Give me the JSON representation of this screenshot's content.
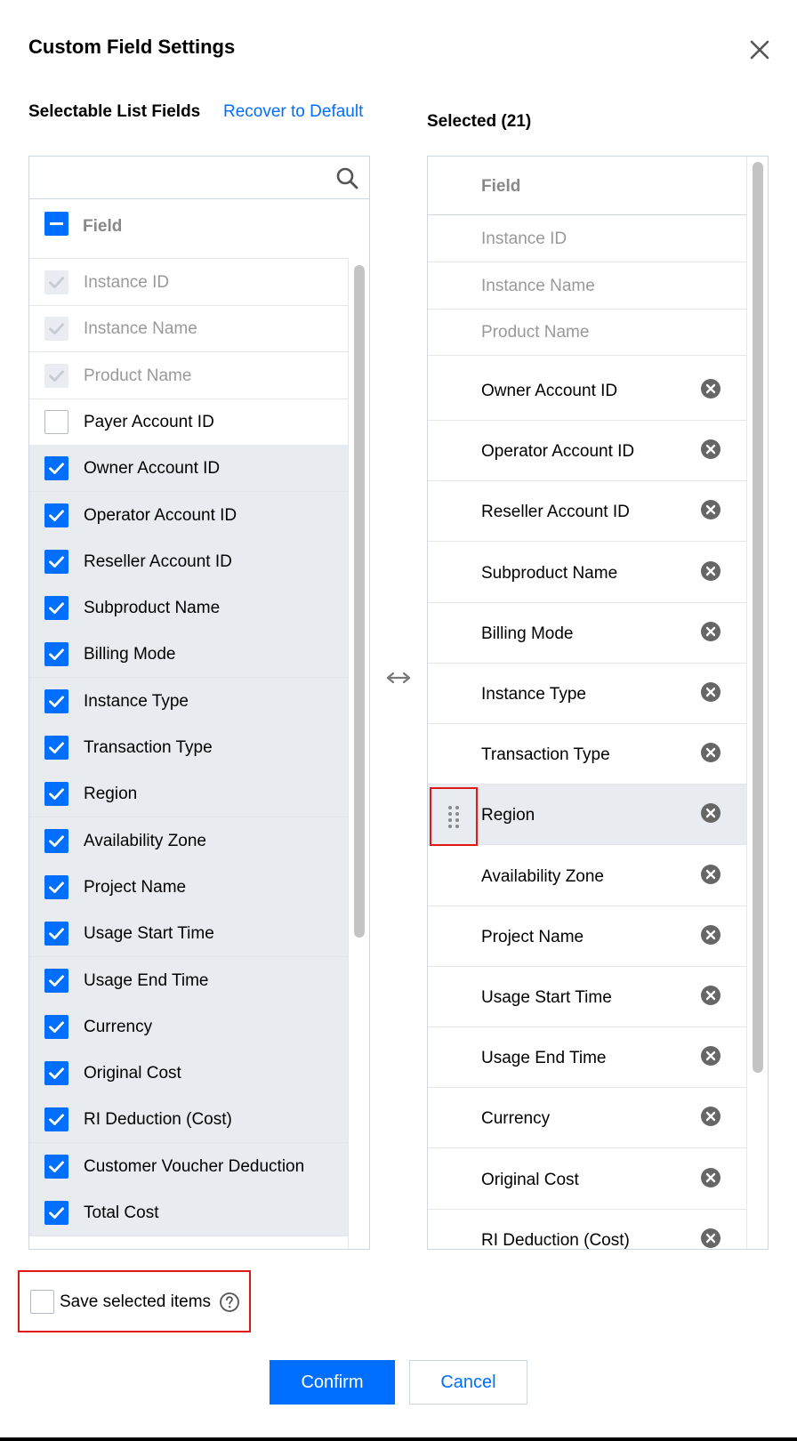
{
  "dialog": {
    "title": "Custom Field Settings",
    "close_icon": "close-icon"
  },
  "left": {
    "heading": "Selectable List Fields",
    "recover_label": "Recover to Default",
    "search": {
      "value": "",
      "placeholder": "",
      "icon": "search-icon"
    },
    "header_label": "Field",
    "header_state": "indeterminate",
    "items": [
      {
        "label": "Instance ID",
        "state": "disabled"
      },
      {
        "label": "Instance Name",
        "state": "disabled"
      },
      {
        "label": "Product Name",
        "state": "disabled"
      },
      {
        "label": "Payer Account ID",
        "state": "unchecked"
      },
      {
        "label": "Owner Account ID",
        "state": "checked"
      },
      {
        "label": "Operator Account ID",
        "state": "checked"
      },
      {
        "label": "Reseller Account ID",
        "state": "checked"
      },
      {
        "label": "Subproduct Name",
        "state": "checked"
      },
      {
        "label": "Billing Mode",
        "state": "checked"
      },
      {
        "label": "Instance Type",
        "state": "checked"
      },
      {
        "label": "Transaction Type",
        "state": "checked"
      },
      {
        "label": "Region",
        "state": "checked"
      },
      {
        "label": "Availability Zone",
        "state": "checked"
      },
      {
        "label": "Project Name",
        "state": "checked"
      },
      {
        "label": "Usage Start Time",
        "state": "checked"
      },
      {
        "label": "Usage End Time",
        "state": "checked"
      },
      {
        "label": "Currency",
        "state": "checked"
      },
      {
        "label": "Original Cost",
        "state": "checked"
      },
      {
        "label": "RI Deduction (Cost)",
        "state": "checked"
      },
      {
        "label": "Customer Voucher Deduction",
        "state": "checked"
      },
      {
        "label": "Total Cost",
        "state": "checked"
      }
    ]
  },
  "swap_icon": "swap-arrows-icon",
  "right": {
    "heading": "Selected (21)",
    "header_label": "Field",
    "locked_items": [
      "Instance ID",
      "Instance Name",
      "Product Name"
    ],
    "items": [
      "Owner Account ID",
      "Operator Account ID",
      "Reseller Account ID",
      "Subproduct Name",
      "Billing Mode",
      "Instance Type",
      "Transaction Type",
      "Region",
      "Availability Zone",
      "Project Name",
      "Usage Start Time",
      "Usage End Time",
      "Currency",
      "Original Cost",
      "RI Deduction (Cost)"
    ],
    "active_item": "Region",
    "remove_icon": "remove-circle-icon",
    "drag_icon": "drag-handle-icon"
  },
  "footer": {
    "save_label": "Save selected items",
    "save_checked": false,
    "help_icon": "help-icon",
    "confirm_label": "Confirm",
    "cancel_label": "Cancel"
  },
  "colors": {
    "accent": "#006eff",
    "highlight_border": "#e01818",
    "selected_row_bg": "#e8ebf0"
  }
}
